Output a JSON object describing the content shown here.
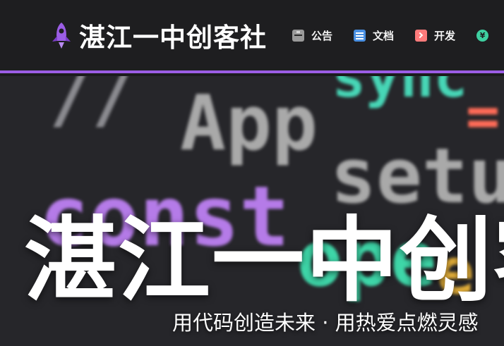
{
  "brand": {
    "title": "湛江一中创客社",
    "logo_icon": "rocket-icon",
    "accent_color": "#9b5de5"
  },
  "nav": {
    "items": [
      {
        "label": "公告",
        "icon": "announcement-icon"
      },
      {
        "label": "文档",
        "icon": "document-icon"
      },
      {
        "label": "开发",
        "icon": "terminal-icon"
      },
      {
        "label": "",
        "icon": "yen-icon"
      }
    ]
  },
  "hero": {
    "title": "湛江一中创客社",
    "subtitle": "用代码创造未来 · 用热爱点燃灵感",
    "background_code": [
      "//",
      "sync",
      "=",
      "App",
      "setup",
      "const",
      "ope",
      "e"
    ]
  }
}
